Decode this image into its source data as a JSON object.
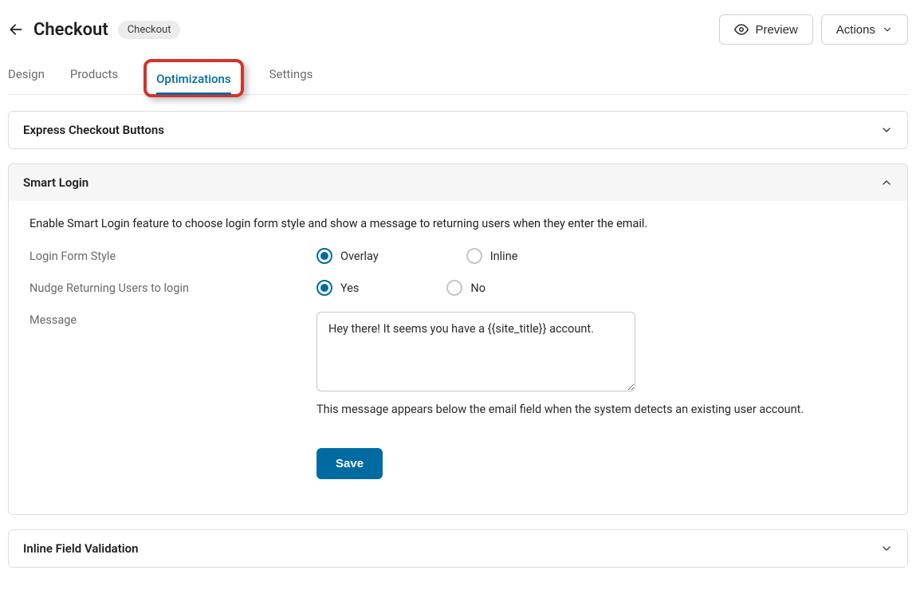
{
  "header": {
    "title": "Checkout",
    "badge": "Checkout",
    "preview_label": "Preview",
    "actions_label": "Actions"
  },
  "tabs": {
    "design": "Design",
    "products": "Products",
    "optimizations": "Optimizations",
    "settings": "Settings"
  },
  "panels": {
    "express": {
      "title": "Express Checkout Buttons"
    },
    "smart_login": {
      "title": "Smart Login",
      "description": "Enable Smart Login feature to choose login form style and show a message to returning users when they enter the email.",
      "login_form_style": {
        "label": "Login Form Style",
        "overlay": "Overlay",
        "inline": "Inline"
      },
      "nudge": {
        "label": "Nudge Returning Users to login",
        "yes": "Yes",
        "no": "No"
      },
      "message": {
        "label": "Message",
        "value": "Hey there! It seems you have a {{site_title}} account.",
        "help": "This message appears below the email field when the system detects an existing user account."
      },
      "save_label": "Save"
    },
    "inline_validation": {
      "title": "Inline Field Validation"
    }
  }
}
